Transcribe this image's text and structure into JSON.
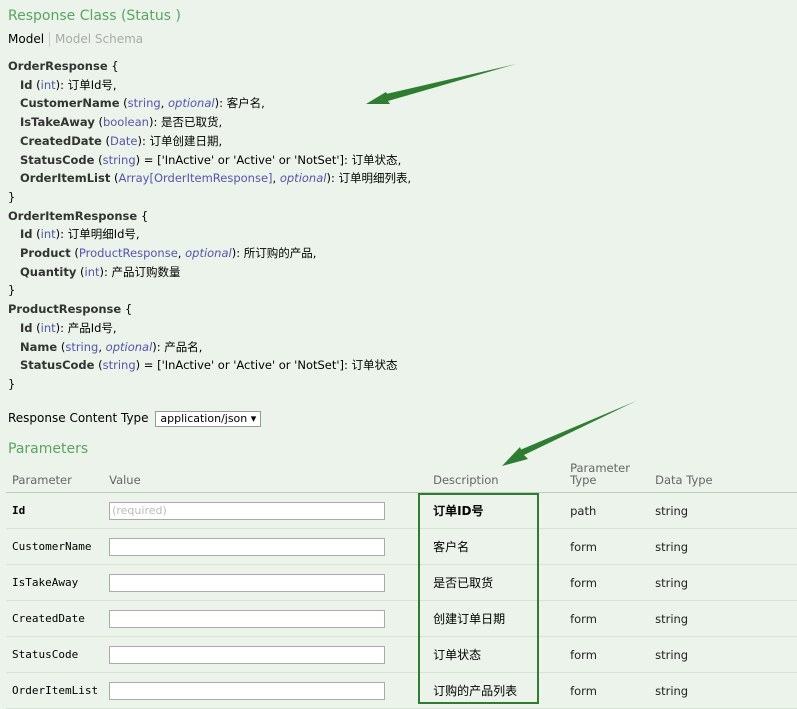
{
  "header": {
    "title": "Response Class (Status )",
    "tab_model": "Model",
    "tab_schema": "Model Schema"
  },
  "schema": [
    {
      "name": "OrderResponse",
      "fields": [
        {
          "name": "Id",
          "type": "int",
          "desc": "订单Id号"
        },
        {
          "name": "CustomerName",
          "type": "string",
          "opt": "optional",
          "desc": "客户名"
        },
        {
          "name": "IsTakeAway",
          "type": "boolean",
          "desc": "是否已取货"
        },
        {
          "name": "CreatedDate",
          "type": "Date",
          "desc": "订单创建日期"
        },
        {
          "name": "StatusCode",
          "type": "string",
          "enum": "['InActive' or 'Active' or 'NotSet']",
          "desc": "订单状态"
        },
        {
          "name": "OrderItemList",
          "type": "Array[OrderItemResponse]",
          "opt": "optional",
          "desc": "订单明细列表"
        }
      ]
    },
    {
      "name": "OrderItemResponse",
      "fields": [
        {
          "name": "Id",
          "type": "int",
          "desc": "订单明细Id号"
        },
        {
          "name": "Product",
          "type": "ProductResponse",
          "opt": "optional",
          "desc": "所订购的产品"
        },
        {
          "name": "Quantity",
          "type": "int",
          "desc": "产品订购数量"
        }
      ]
    },
    {
      "name": "ProductResponse",
      "fields": [
        {
          "name": "Id",
          "type": "int",
          "desc": "产品Id号"
        },
        {
          "name": "Name",
          "type": "string",
          "opt": "optional",
          "desc": "产品名"
        },
        {
          "name": "StatusCode",
          "type": "string",
          "enum": "['InActive' or 'Active' or 'NotSet']",
          "desc": "订单状态"
        }
      ]
    }
  ],
  "response_content": {
    "label": "Response Content Type",
    "selected": "application/json ▾"
  },
  "parameters": {
    "title": "Parameters",
    "headers": [
      "Parameter",
      "Value",
      "Description",
      "Parameter Type",
      "Data Type"
    ],
    "rows": [
      {
        "name": "Id",
        "placeholder": "(required)",
        "desc": "订单ID号",
        "ptype": "path",
        "dtype": "string",
        "required": true
      },
      {
        "name": "CustomerName",
        "placeholder": "",
        "desc": "客户名",
        "ptype": "form",
        "dtype": "string"
      },
      {
        "name": "IsTakeAway",
        "placeholder": "",
        "desc": "是否已取货",
        "ptype": "form",
        "dtype": "string"
      },
      {
        "name": "CreatedDate",
        "placeholder": "",
        "desc": "创建订单日期",
        "ptype": "form",
        "dtype": "string"
      },
      {
        "name": "StatusCode",
        "placeholder": "",
        "desc": "订单状态",
        "ptype": "form",
        "dtype": "string"
      },
      {
        "name": "OrderItemList",
        "placeholder": "",
        "desc": "订购的产品列表",
        "ptype": "form",
        "dtype": "string"
      }
    ]
  },
  "colors": {
    "accent": "#5aa561",
    "annotation": "#2e7d32",
    "background": "#ebf3ea"
  }
}
